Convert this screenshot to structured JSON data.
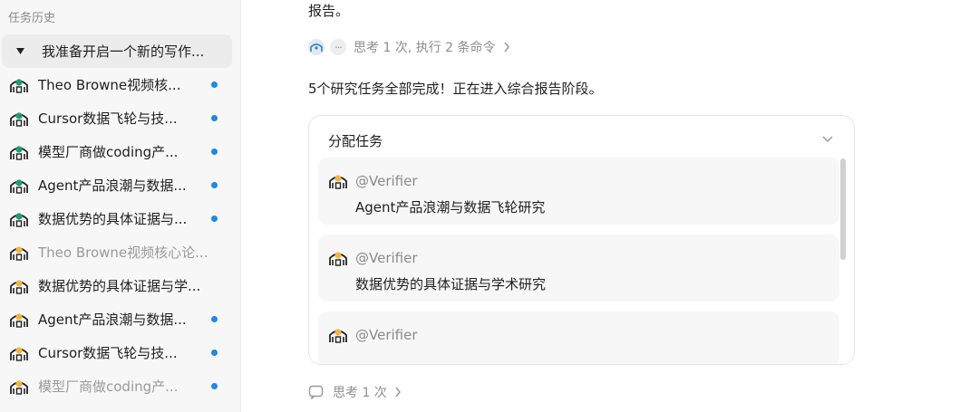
{
  "sidebar": {
    "heading": "任务历史",
    "items": [
      {
        "label": "我准备开启一个新的写作...",
        "icon": "caret-down-icon",
        "active": true,
        "muted": false,
        "unread": false
      },
      {
        "label": "Theo Browne视频核...",
        "icon": "agent-green-icon",
        "active": false,
        "muted": false,
        "unread": true
      },
      {
        "label": "Cursor数据飞轮与技...",
        "icon": "agent-green-icon",
        "active": false,
        "muted": false,
        "unread": true
      },
      {
        "label": "模型厂商做coding产...",
        "icon": "agent-green-icon",
        "active": false,
        "muted": false,
        "unread": true
      },
      {
        "label": "Agent产品浪潮与数据...",
        "icon": "agent-green-icon",
        "active": false,
        "muted": false,
        "unread": true
      },
      {
        "label": "数据优势的具体证据与...",
        "icon": "agent-green-icon",
        "active": false,
        "muted": false,
        "unread": true
      },
      {
        "label": "Theo Browne视频核心论...",
        "icon": "agent-yellow-icon",
        "active": false,
        "muted": true,
        "unread": false
      },
      {
        "label": "数据优势的具体证据与学...",
        "icon": "agent-yellow-icon",
        "active": false,
        "muted": false,
        "unread": false
      },
      {
        "label": "Agent产品浪潮与数据...",
        "icon": "agent-yellow-icon",
        "active": false,
        "muted": false,
        "unread": true
      },
      {
        "label": "Cursor数据飞轮与技...",
        "icon": "agent-yellow-icon",
        "active": false,
        "muted": false,
        "unread": true
      },
      {
        "label": "模型厂商做coding产...",
        "icon": "agent-yellow-icon",
        "active": false,
        "muted": true,
        "unread": true
      }
    ]
  },
  "main": {
    "fragment": "报告。",
    "think_summary": "思考 1 次, 执行 2 条命令",
    "more_glyph": "···",
    "status": "5个研究任务全部完成！正在进入综合报告阶段。",
    "card": {
      "title": "分配任务",
      "tasks": [
        {
          "who": "@Verifier",
          "desc": "Agent产品浪潮与数据飞轮研究"
        },
        {
          "who": "@Verifier",
          "desc": "数据优势的具体证据与学术研究"
        },
        {
          "who": "@Verifier",
          "desc": ""
        }
      ]
    },
    "think2": "思考 1 次"
  },
  "colors": {
    "unread_dot": "#1e88e5",
    "agent_green": "#1f9d6b",
    "agent_yellow": "#f2b544"
  }
}
